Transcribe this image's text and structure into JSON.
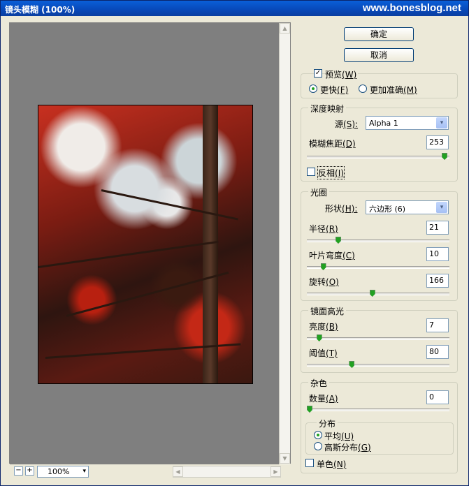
{
  "window": {
    "title": "镜头模糊 (100%)",
    "watermark": "www.bonesblog.net"
  },
  "preview": {
    "zoom": "100%",
    "zoom_out": "−",
    "zoom_in": "+"
  },
  "buttons": {
    "ok": "确定",
    "cancel": "取消"
  },
  "preview_options": {
    "preview_label": "预览",
    "preview_key": "(W)",
    "preview_checked": true,
    "faster_label": "更快",
    "faster_key": "(F)",
    "accurate_label": "更加准确",
    "accurate_key": "(M)",
    "selected": "faster"
  },
  "depth_map": {
    "legend": "深度映射",
    "source_label": "源",
    "source_key": "(S):",
    "source_value": "Alpha 1",
    "blur_focal_label": "模糊焦距",
    "blur_focal_key": "(D)",
    "blur_focal_value": "253",
    "blur_focal_fraction": 0.99,
    "invert_label": "反相",
    "invert_key": "(I)",
    "invert_checked": false
  },
  "iris": {
    "legend": "光圈",
    "shape_label": "形状",
    "shape_key": "(H):",
    "shape_value": "六边形 (6)",
    "radius_label": "半径",
    "radius_key": "(R)",
    "radius_value": "21",
    "radius_fraction": 0.21,
    "curvature_label": "叶片弯度",
    "curvature_key": "(C)",
    "curvature_value": "10",
    "curvature_fraction": 0.1,
    "rotation_label": "旋转",
    "rotation_key": "(O)",
    "rotation_value": "166",
    "rotation_fraction": 0.46
  },
  "specular": {
    "legend": "镜面高光",
    "brightness_label": "亮度",
    "brightness_key": "(B)",
    "brightness_value": "7",
    "brightness_fraction": 0.07,
    "threshold_label": "阈值",
    "threshold_key": "(T)",
    "threshold_value": "80",
    "threshold_fraction": 0.31
  },
  "noise": {
    "legend": "杂色",
    "amount_label": "数量",
    "amount_key": "(A)",
    "amount_value": "0",
    "amount_fraction": 0,
    "distribution_legend": "分布",
    "uniform_label": "平均",
    "uniform_key": "(U)",
    "gaussian_label": "高斯分布",
    "gaussian_key": "(G)",
    "selected": "uniform",
    "mono_label": "单色",
    "mono_key": "(N)",
    "mono_checked": false
  },
  "icons": {
    "check": "✓",
    "dropdown": "▾",
    "up": "▲",
    "down": "▼",
    "left": "◀",
    "right": "▶"
  }
}
